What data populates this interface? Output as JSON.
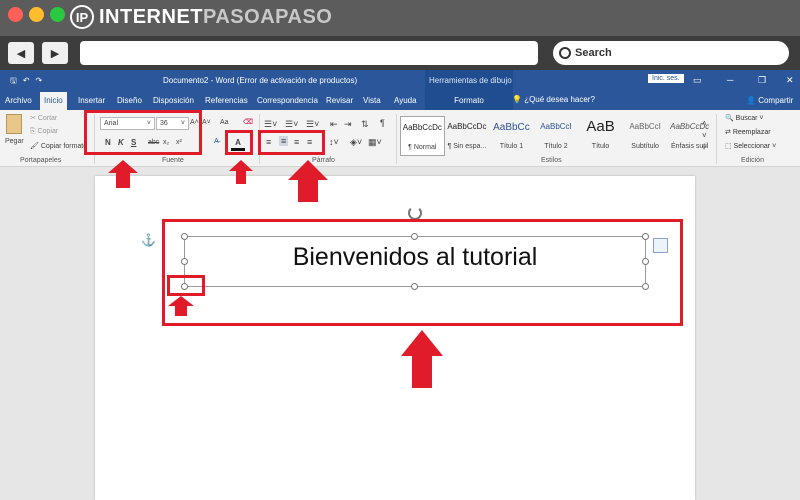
{
  "site": {
    "logo_mark": "IP",
    "logo_text_1": "INTERNET",
    "logo_text_2": "PASOAPASO"
  },
  "browser": {
    "back_icon": "back-arrow-icon",
    "forward_icon": "forward-arrow-icon",
    "search_label": "Search"
  },
  "word": {
    "document_title": "Documento2 - Word (Error de activación de productos)",
    "contextual_tools": "Herramientas de dibujo",
    "sign_in": "Inic. ses.",
    "tabs": [
      "Archivo",
      "Inicio",
      "Insertar",
      "Diseño",
      "Disposición",
      "Referencias",
      "Correspondencia",
      "Revisar",
      "Vista",
      "Ayuda"
    ],
    "format_tab": "Formato",
    "tell_me": "¿Qué desea hacer?",
    "share": "Compartir"
  },
  "clipboard": {
    "paste": "Pegar",
    "cut": "Cortar",
    "copy": "Copiar",
    "format_painter": "Copiar formato",
    "label": "Portapapeles"
  },
  "font": {
    "name": "Arial",
    "size": "36",
    "label": "Fuente",
    "bold": "N",
    "italic": "K",
    "underline": "S",
    "strike": "abc",
    "subscript": "x₂",
    "superscript": "x²",
    "grow": "A˄",
    "shrink": "A˅",
    "case": "Aa",
    "color_letter": "A"
  },
  "paragraph": {
    "label": "Párrafo",
    "pilcrow": "¶"
  },
  "styles": {
    "label": "Estilos",
    "items": [
      {
        "sample": "AaBbCcDc",
        "name": "¶ Normal"
      },
      {
        "sample": "AaBbCcDc",
        "name": "¶ Sin espa..."
      },
      {
        "sample": "AaBbCc",
        "name": "Título 1"
      },
      {
        "sample": "AaBbCcI",
        "name": "Título 2"
      },
      {
        "sample": "AaB",
        "name": "Título"
      },
      {
        "sample": "AaBbCcI",
        "name": "Subtítulo"
      },
      {
        "sample": "AaBbCcDc",
        "name": "Énfasis sutil"
      }
    ]
  },
  "editing": {
    "find": "Buscar",
    "replace": "Reemplazar",
    "select": "Seleccionar",
    "label": "Edición"
  },
  "document": {
    "textbox_text": "Bienvenidos al tutorial"
  },
  "colors": {
    "accent": "#2b579a",
    "annotation": "#e01c2a"
  }
}
